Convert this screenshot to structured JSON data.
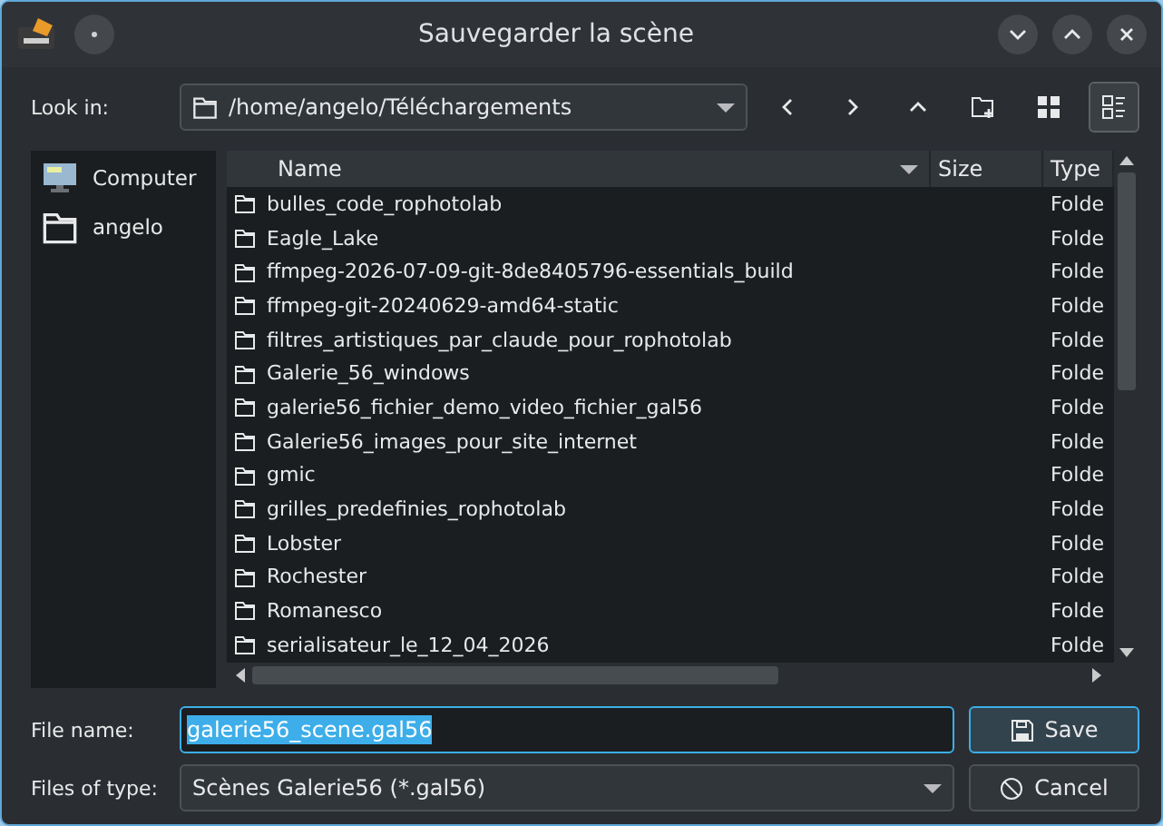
{
  "window": {
    "title": "Sauvegarder la scène"
  },
  "look_in": {
    "label": "Look in:",
    "path": "/home/angelo/Téléchargements"
  },
  "view_buttons": [
    {
      "kind": "list",
      "selected": false
    },
    {
      "kind": "detail",
      "selected": true
    }
  ],
  "sidebar": {
    "items": [
      {
        "kind": "computer",
        "label": "Computer",
        "selected": false
      },
      {
        "kind": "folder",
        "label": "angelo",
        "selected": false
      }
    ]
  },
  "table": {
    "columns": [
      "Name",
      "Size",
      "Type"
    ],
    "rows": [
      {
        "name": "bulles_code_rophotolab",
        "type": "Folde"
      },
      {
        "name": "Eagle_Lake",
        "type": "Folde"
      },
      {
        "name": "ffmpeg-2026-07-09-git-8de8405796-essentials_build",
        "type": "Folde"
      },
      {
        "name": "ffmpeg-git-20240629-amd64-static",
        "type": "Folde"
      },
      {
        "name": "filtres_artistiques_par_claude_pour_rophotolab",
        "type": "Folde"
      },
      {
        "name": "Galerie_56_windows",
        "type": "Folde"
      },
      {
        "name": "galerie56_fichier_demo_video_fichier_gal56",
        "type": "Folde"
      },
      {
        "name": "Galerie56_images_pour_site_internet",
        "type": "Folde"
      },
      {
        "name": "gmic",
        "type": "Folde"
      },
      {
        "name": "grilles_predefinies_rophotolab",
        "type": "Folde"
      },
      {
        "name": "Lobster",
        "type": "Folde"
      },
      {
        "name": "Rochester",
        "type": "Folde"
      },
      {
        "name": "Romanesco",
        "type": "Folde"
      },
      {
        "name": "serialisateur_le_12_04_2026",
        "type": "Folde"
      }
    ]
  },
  "file_name": {
    "label": "File name:",
    "value": "galerie56_scene.gal56"
  },
  "file_type": {
    "label": "Files of type:",
    "value": "Scènes Galerie56 (*.gal56)"
  },
  "buttons": [
    {
      "kind": "save",
      "label": "Save"
    },
    {
      "kind": "cancel",
      "label": "Cancel"
    }
  ]
}
